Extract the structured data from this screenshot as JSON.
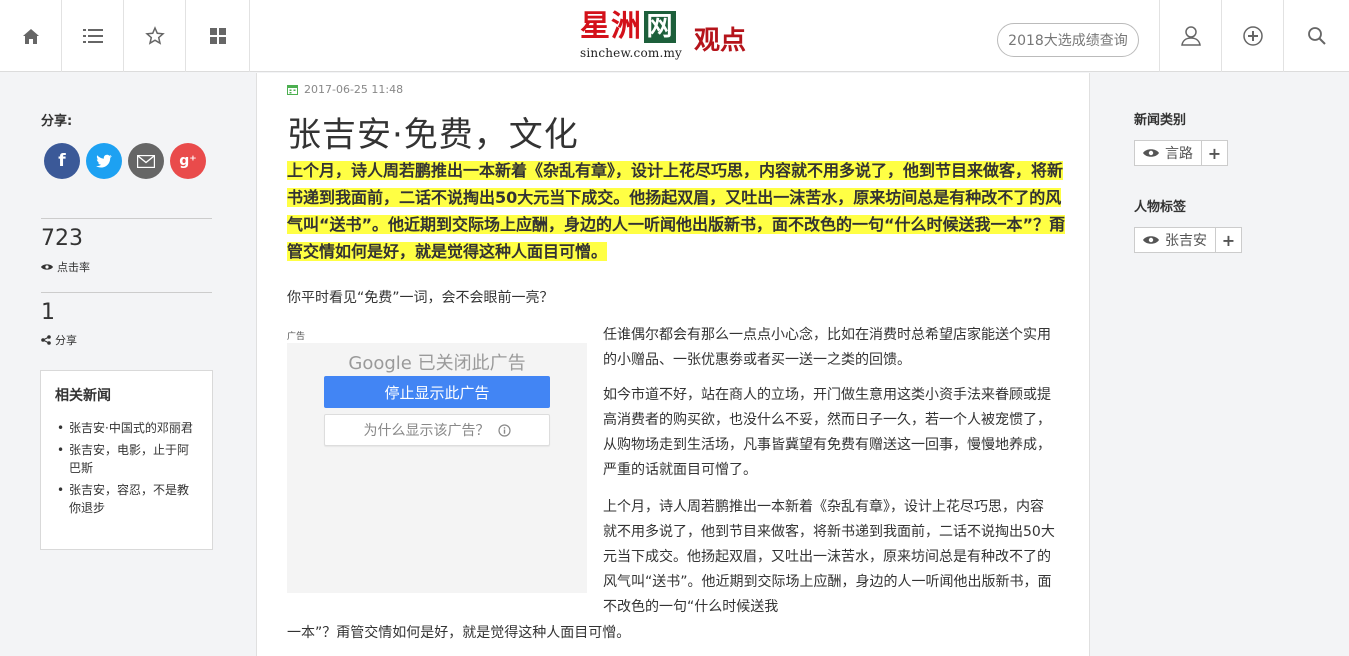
{
  "header": {
    "logo_cn": "星洲",
    "logo_wang": "网",
    "logo_url": "sinchew.com.my",
    "section": "观点",
    "election_button": "2018大选成绩查询"
  },
  "left": {
    "share_label": "分享:",
    "views_count": "723",
    "views_label": "点击率",
    "shares_count": "1",
    "shares_label": "分享",
    "related_title": "相关新闻",
    "related_items": [
      "张吉安·中国式的邓丽君",
      "张吉安，电影，止于阿巴斯",
      "张吉安，容忍，不是教你退步"
    ]
  },
  "article": {
    "date": "2017-06-25 11:48",
    "title": "张吉安·免费，文化",
    "lead": "上个月，诗人周若鹏推出一本新着《杂乱有章》，设计上花尽巧思，内容就不用多说了，他到节目来做客，将新书递到我面前，二话不说掏出50大元当下成交。他扬起双眉，又吐出一沫苦水，原来坊间总是有种改不了的风气叫“送书”。他近期到交际场上应酬，身边的人一听闻他出版新书，面不改色的一句“什么时候送我一本”？甭管交情如何是好，就是觉得这种人面目可憎。",
    "question": "你平时看见“免费”一词，会不会眼前一亮？",
    "ad_label": "广告",
    "ad_google": "Google 已关闭此广告",
    "ad_stop": "停止显示此广告",
    "ad_why": "为什么显示该广告？",
    "p1": "任谁偶尔都会有那么一点点小心念，比如在消费时总希望店家能送个实用的小赠品、一张优惠劵或者买一送一之类的回馈。",
    "p2": "如今市道不好，站在商人的立场，开门做生意用这类小资手法来眷顾或提高消费者的购买欲，也没什么不妥，然而日子一久，若一个人被宠惯了，从购物场走到生活场，凡事皆冀望有免费有赠送这一回事，慢慢地养成，严重的话就面目可憎了。",
    "p3": "上个月，诗人周若鹏推出一本新着《杂乱有章》，设计上花尽巧思，内容就不用多说了，他到节目来做客，将新书递到我面前，二话不说掏出50大元当下成交。他扬起双眉，又吐出一沫苦水，原来坊间总是有种改不了的风气叫“送书”。他近期到交际场上应酬，身边的人一听闻他出版新书，面不改色的一句“什么时候送我",
    "p3_tail": "一本”？甭管交情如何是好，就是觉得这种人面目可憎。"
  },
  "right": {
    "category_title": "新闻类别",
    "category_tag": "言路",
    "people_title": "人物标签",
    "people_tag": "张吉安"
  },
  "colors": {
    "highlight": "#ffff44",
    "brand_red": "#d3111a",
    "google_blue": "#4285f4",
    "facebook": "#3b5998",
    "twitter": "#1da1f2",
    "email": "#666666",
    "googleplus": "#e94b4b"
  }
}
